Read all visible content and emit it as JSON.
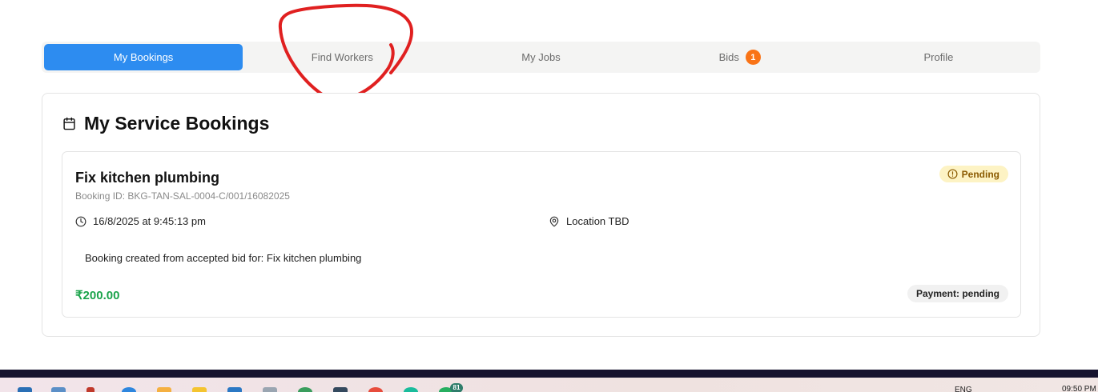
{
  "tabs": [
    {
      "label": "My Bookings",
      "active": true
    },
    {
      "label": "Find Workers",
      "active": false
    },
    {
      "label": "My Jobs",
      "active": false
    },
    {
      "label": "Bids",
      "active": false,
      "badge": "1"
    },
    {
      "label": "Profile",
      "active": false
    }
  ],
  "section": {
    "title": "My Service Bookings",
    "icon": "calendar-icon"
  },
  "booking": {
    "title": "Fix kitchen plumbing",
    "booking_id": "Booking ID: BKG-TAN-SAL-0004-C/001/16082025",
    "status": "Pending",
    "datetime": "16/8/2025 at 9:45:13 pm",
    "location": "Location TBD",
    "note": "Booking created from accepted bid for: Fix kitchen plumbing",
    "amount": "₹200.00",
    "payment": "Payment: pending"
  },
  "taskbar": {
    "badge": "81",
    "language": "ENG",
    "time": "09:50 PM"
  },
  "colors": {
    "active_tab": "#2d8cf0",
    "bids_badge": "#f97316",
    "pending_badge_bg": "#fdf3c4",
    "amount": "#1aa34a",
    "annotation": "#e02020"
  }
}
